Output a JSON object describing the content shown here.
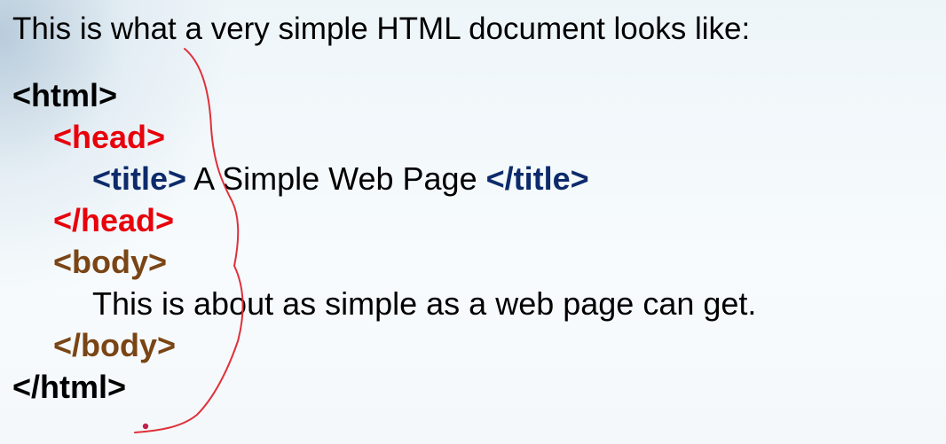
{
  "intro": "This is what a very simple HTML document looks like:",
  "code": {
    "html_open": "<html>",
    "head_open": "<head>",
    "title_open": "<title>",
    "title_text": " A Simple Web Page ",
    "title_close": "</title>",
    "head_close": "</head>",
    "body_open": "<body>",
    "body_text": "This is about as simple as a web page can get.",
    "body_close": "</body>",
    "html_close": "</html>"
  },
  "colors": {
    "html_tags": "#000000",
    "head_tags": "#e8000b",
    "title_tags": "#0d2b6b",
    "body_tags": "#7a4515",
    "annotation_ink": "#e0303a",
    "annotation_dot": "#c0204a"
  }
}
